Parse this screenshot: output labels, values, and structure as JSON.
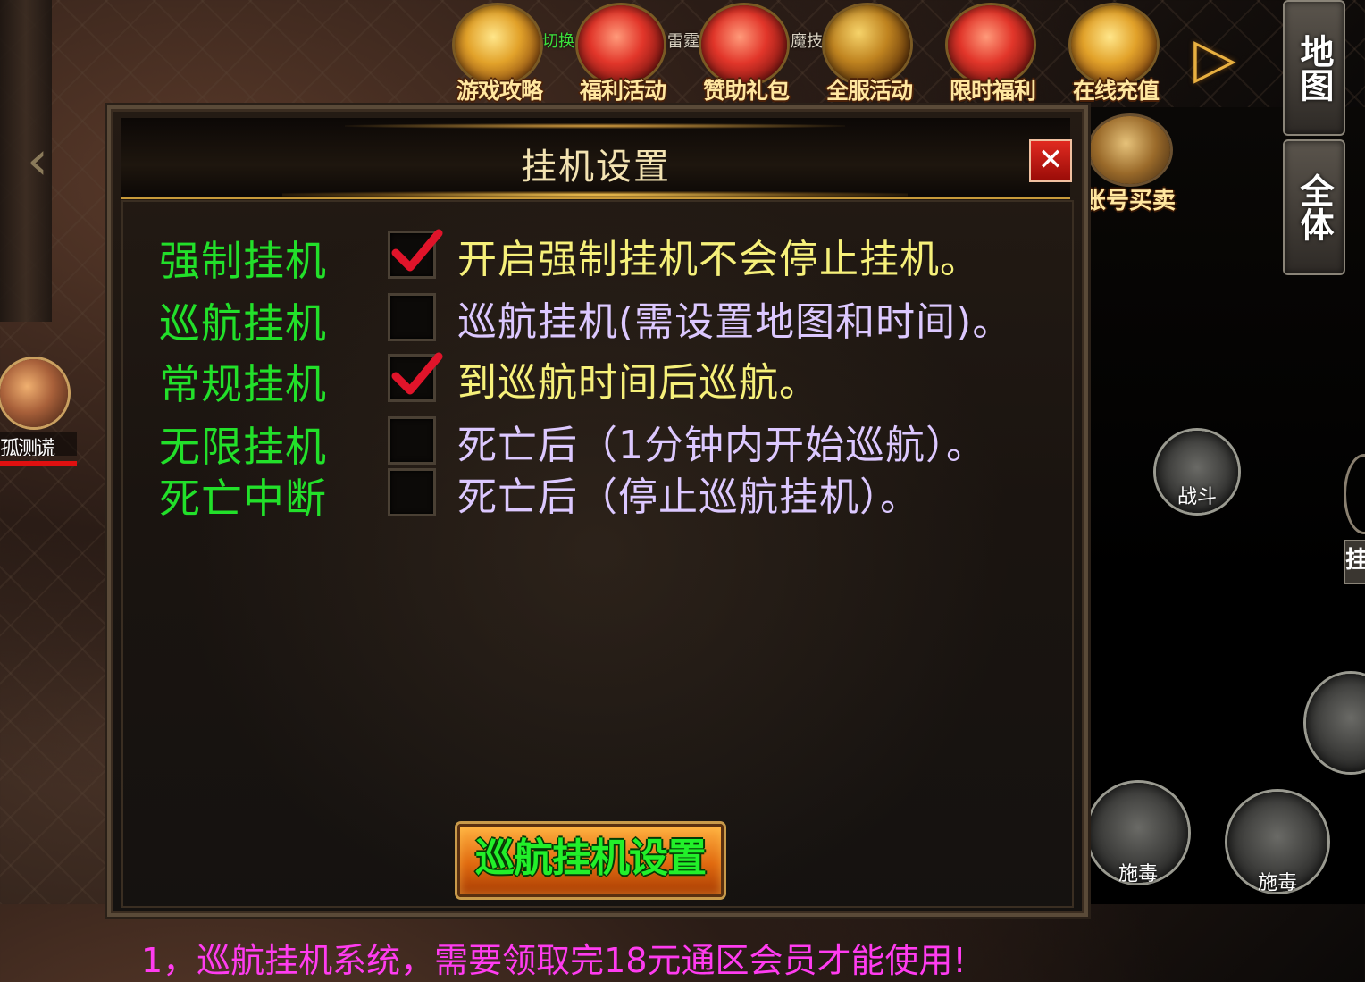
{
  "top_menu": {
    "items": [
      {
        "label": "游戏攻略",
        "icon": "scroll-icon"
      },
      {
        "label": "福利活动",
        "icon": "gift-box-icon"
      },
      {
        "label": "赞助礼包",
        "icon": "treasure-bag-icon"
      },
      {
        "label": "全服活动",
        "icon": "crossed-swords-icon"
      },
      {
        "label": "限时福利",
        "icon": "red-envelope-icon"
      },
      {
        "label": "在线充值",
        "icon": "gem-bag-icon"
      }
    ],
    "partial_tags": [
      "切换",
      "雷霆",
      "魔技"
    ]
  },
  "right_buttons": {
    "map": "地图",
    "all": "全体"
  },
  "account_trade": {
    "label": "账号买卖"
  },
  "player": {
    "name": "孤测谎"
  },
  "skills": {
    "battle": "战斗",
    "skill1": "施毒",
    "skill2": "施毒",
    "edge": "挂"
  },
  "dialog": {
    "title": "挂机设置",
    "close": "✕",
    "options": [
      {
        "name": "强制挂机",
        "desc": "开启强制挂机不会停止挂机。",
        "checked": true
      },
      {
        "name": "巡航挂机",
        "desc": "巡航挂机(需设置地图和时间)。",
        "checked": false
      },
      {
        "name": "常规挂机",
        "desc": "到巡航时间后巡航。",
        "checked": true
      },
      {
        "name": "无限挂机",
        "desc": "死亡后（1分钟内开始巡航）。",
        "checked": false
      },
      {
        "name": "死亡中断",
        "desc": "死亡后（停止巡航挂机）。",
        "checked": false
      }
    ],
    "cruise_button": "巡航挂机设置",
    "notice": "1，巡航挂机系统，需要领取完18元通区会员才能使用!"
  },
  "colors": {
    "option_name": "#22e02a",
    "desc_yellow": "#f6f07a",
    "desc_lavender": "#dcc8ff",
    "notice": "#ff3cf0",
    "check": "#e0142a"
  }
}
